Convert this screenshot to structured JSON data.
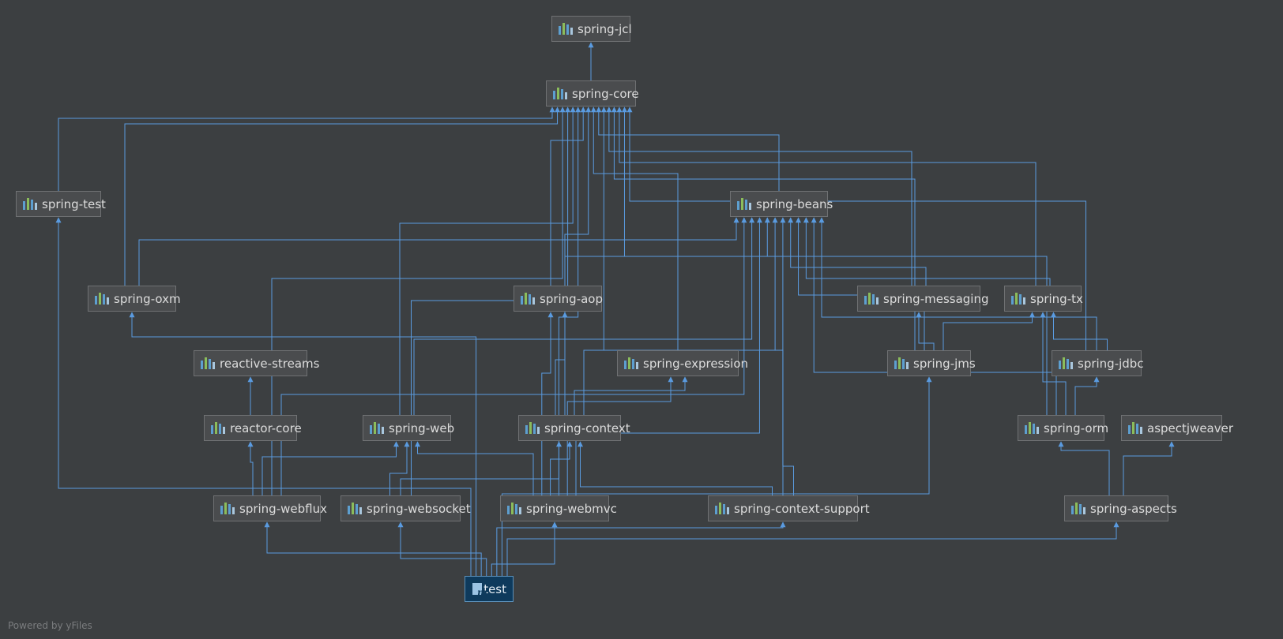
{
  "diagram": {
    "nodes": [
      {
        "id": "spring-jcl",
        "label": "spring-jcl"
      },
      {
        "id": "spring-core",
        "label": "spring-core"
      },
      {
        "id": "spring-test",
        "label": "spring-test"
      },
      {
        "id": "spring-beans",
        "label": "spring-beans"
      },
      {
        "id": "spring-oxm",
        "label": "spring-oxm"
      },
      {
        "id": "spring-aop",
        "label": "spring-aop"
      },
      {
        "id": "spring-messaging",
        "label": "spring-messaging"
      },
      {
        "id": "spring-tx",
        "label": "spring-tx"
      },
      {
        "id": "reactive-streams",
        "label": "reactive-streams"
      },
      {
        "id": "spring-expression",
        "label": "spring-expression"
      },
      {
        "id": "spring-jms",
        "label": "spring-jms"
      },
      {
        "id": "spring-jdbc",
        "label": "spring-jdbc"
      },
      {
        "id": "reactor-core",
        "label": "reactor-core"
      },
      {
        "id": "spring-web",
        "label": "spring-web"
      },
      {
        "id": "spring-context",
        "label": "spring-context"
      },
      {
        "id": "spring-orm",
        "label": "spring-orm"
      },
      {
        "id": "aspectjweaver",
        "label": "aspectjweaver"
      },
      {
        "id": "spring-webflux",
        "label": "spring-webflux"
      },
      {
        "id": "spring-websocket",
        "label": "spring-websocket"
      },
      {
        "id": "spring-webmvc",
        "label": "spring-webmvc"
      },
      {
        "id": "spring-context-support",
        "label": "spring-context-support"
      },
      {
        "id": "spring-aspects",
        "label": "spring-aspects"
      },
      {
        "id": "test",
        "label": "test",
        "root": true
      }
    ],
    "edges": [
      [
        "spring-core",
        "spring-jcl"
      ],
      [
        "spring-test",
        "spring-core"
      ],
      [
        "spring-oxm",
        "spring-core"
      ],
      [
        "spring-oxm",
        "spring-beans"
      ],
      [
        "spring-beans",
        "spring-core"
      ],
      [
        "spring-aop",
        "spring-core"
      ],
      [
        "spring-aop",
        "spring-beans"
      ],
      [
        "spring-messaging",
        "spring-core"
      ],
      [
        "spring-messaging",
        "spring-beans"
      ],
      [
        "spring-tx",
        "spring-core"
      ],
      [
        "spring-tx",
        "spring-beans"
      ],
      [
        "spring-expression",
        "spring-core"
      ],
      [
        "spring-jms",
        "spring-core"
      ],
      [
        "spring-jms",
        "spring-beans"
      ],
      [
        "spring-jms",
        "spring-messaging"
      ],
      [
        "spring-jms",
        "spring-tx"
      ],
      [
        "spring-jdbc",
        "spring-core"
      ],
      [
        "spring-jdbc",
        "spring-beans"
      ],
      [
        "spring-jdbc",
        "spring-tx"
      ],
      [
        "reactor-core",
        "reactive-streams"
      ],
      [
        "spring-web",
        "spring-core"
      ],
      [
        "spring-web",
        "spring-beans"
      ],
      [
        "spring-context",
        "spring-core"
      ],
      [
        "spring-context",
        "spring-beans"
      ],
      [
        "spring-context",
        "spring-aop"
      ],
      [
        "spring-context",
        "spring-expression"
      ],
      [
        "spring-orm",
        "spring-core"
      ],
      [
        "spring-orm",
        "spring-beans"
      ],
      [
        "spring-orm",
        "spring-tx"
      ],
      [
        "spring-orm",
        "spring-jdbc"
      ],
      [
        "spring-webflux",
        "spring-core"
      ],
      [
        "spring-webflux",
        "spring-beans"
      ],
      [
        "spring-webflux",
        "spring-web"
      ],
      [
        "spring-webflux",
        "reactor-core"
      ],
      [
        "spring-websocket",
        "spring-core"
      ],
      [
        "spring-websocket",
        "spring-web"
      ],
      [
        "spring-websocket",
        "spring-context"
      ],
      [
        "spring-webmvc",
        "spring-core"
      ],
      [
        "spring-webmvc",
        "spring-beans"
      ],
      [
        "spring-webmvc",
        "spring-web"
      ],
      [
        "spring-webmvc",
        "spring-context"
      ],
      [
        "spring-webmvc",
        "spring-aop"
      ],
      [
        "spring-webmvc",
        "spring-expression"
      ],
      [
        "spring-context-support",
        "spring-core"
      ],
      [
        "spring-context-support",
        "spring-beans"
      ],
      [
        "spring-context-support",
        "spring-context"
      ],
      [
        "spring-aspects",
        "spring-orm"
      ],
      [
        "spring-aspects",
        "aspectjweaver"
      ],
      [
        "test",
        "spring-test"
      ],
      [
        "test",
        "spring-oxm"
      ],
      [
        "test",
        "spring-webflux"
      ],
      [
        "test",
        "spring-websocket"
      ],
      [
        "test",
        "spring-webmvc"
      ],
      [
        "test",
        "spring-context-support"
      ],
      [
        "test",
        "spring-jms"
      ],
      [
        "test",
        "spring-aspects"
      ]
    ]
  },
  "colors": {
    "background": "#3c3f41",
    "edge": "#5a9be0",
    "node": "#4a4c4e",
    "root": "#0e3a5c"
  },
  "footer": "Powered by yFiles"
}
